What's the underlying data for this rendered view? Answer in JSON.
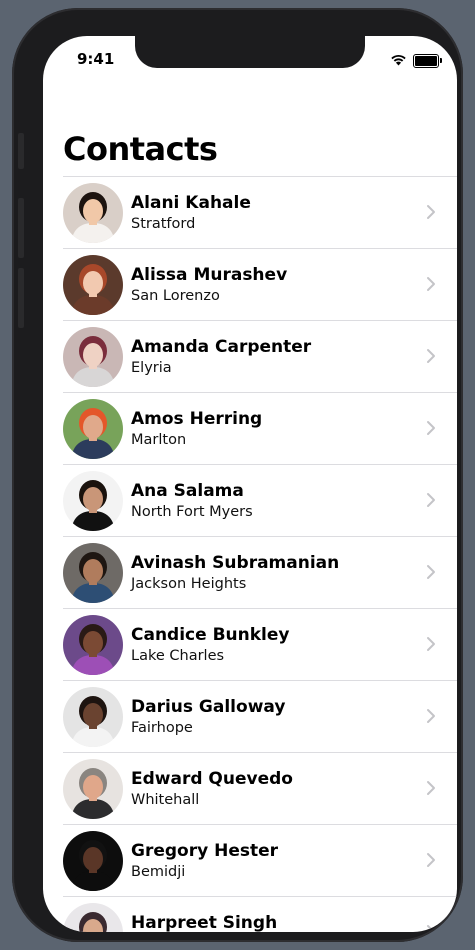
{
  "status": {
    "time": "9:41"
  },
  "header": {
    "title": "Contacts"
  },
  "contacts": [
    {
      "name": "Alani Kahale",
      "city": "Stratford",
      "avatar": "avatar-photo",
      "bg": "#d9cfc8",
      "skin": "#f1c8a8",
      "hair": "#1c130f",
      "shirt": "#f4f1ee"
    },
    {
      "name": "Alissa Murashev",
      "city": "San Lorenzo",
      "avatar": "avatar-photo",
      "bg": "#5b3a2c",
      "skin": "#f2c9b0",
      "hair": "#a8482a",
      "shirt": "#6b3b2a"
    },
    {
      "name": "Amanda Carpenter",
      "city": "Elyria",
      "avatar": "avatar-photo",
      "bg": "#c9b7b5",
      "skin": "#efd2c4",
      "hair": "#7a2d3c",
      "shirt": "#d8d6d6"
    },
    {
      "name": "Amos Herring",
      "city": "Marlton",
      "avatar": "avatar-photo",
      "bg": "#78a35a",
      "skin": "#e0a98b",
      "hair": "#e4572a",
      "shirt": "#2c3c5c"
    },
    {
      "name": "Ana Salama",
      "city": "North Fort Myers",
      "avatar": "avatar-photo",
      "bg": "#f3f3f3",
      "skin": "#c99678",
      "hair": "#1a120d",
      "shirt": "#111111"
    },
    {
      "name": "Avinash Subramanian",
      "city": "Jackson Heights",
      "avatar": "avatar-photo",
      "bg": "#6e6a66",
      "skin": "#b07c5d",
      "hair": "#1e1612",
      "shirt": "#2d4e74"
    },
    {
      "name": "Candice Bunkley",
      "city": "Lake Charles",
      "avatar": "avatar-photo",
      "bg": "#6c4a8a",
      "skin": "#7b4a34",
      "hair": "#2a1a16",
      "shirt": "#9d4fb6"
    },
    {
      "name": "Darius Galloway",
      "city": "Fairhope",
      "avatar": "avatar-photo",
      "bg": "#e4e4e4",
      "skin": "#6a4330",
      "hair": "#1e1410",
      "shirt": "#f3f3f3"
    },
    {
      "name": "Edward Quevedo",
      "city": "Whitehall",
      "avatar": "avatar-photo",
      "bg": "#e7e3e0",
      "skin": "#e0a78a",
      "hair": "#8a8580",
      "shirt": "#2c2c2e"
    },
    {
      "name": "Gregory Hester",
      "city": "Bemidji",
      "avatar": "avatar-photo",
      "bg": "#0d0d0d",
      "skin": "#5a3627",
      "hair": "#111111",
      "shirt": "#0d0d0d"
    },
    {
      "name": "Harpreet Singh",
      "city": "",
      "avatar": "avatar-photo",
      "bg": "#e9e7ea",
      "skin": "#d9a98c",
      "hair": "#3a2a30",
      "shirt": "#8c6f8d"
    }
  ],
  "icons": {
    "row_action": "chevron-right-icon",
    "signal": "wifi-icon",
    "power": "battery-icon"
  }
}
